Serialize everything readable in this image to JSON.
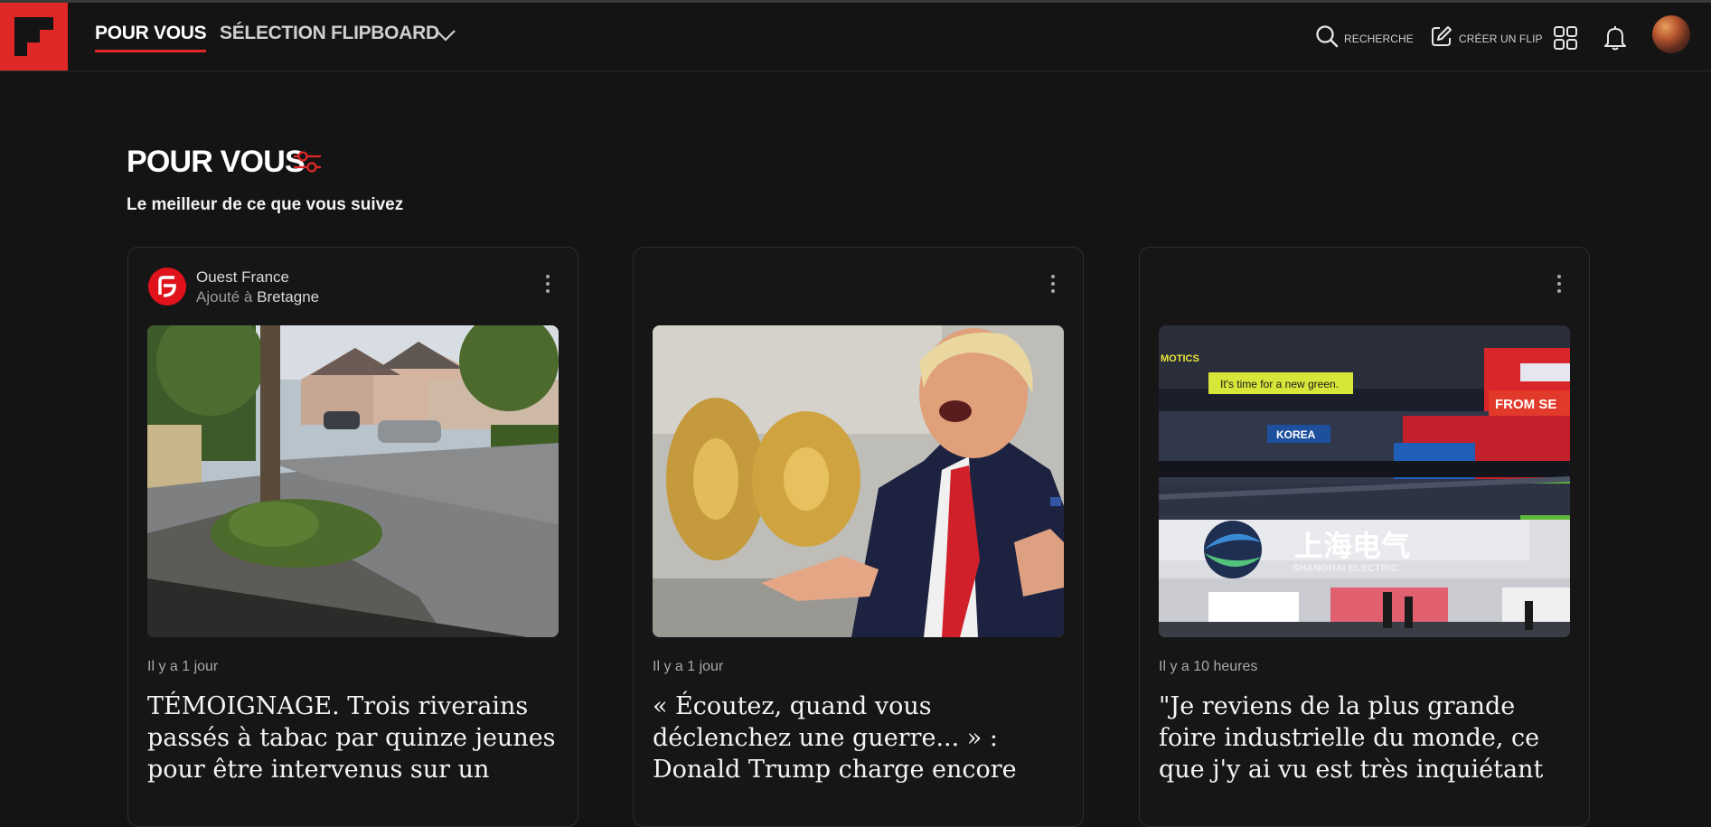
{
  "header": {
    "tabs": [
      {
        "label": "POUR VOUS",
        "active": true
      },
      {
        "label": "SÉLECTION FLIPBOARD",
        "active": false
      }
    ],
    "search_label": "RECHERCHE",
    "create_label": "CRÉER UN FLIP",
    "icons": [
      "flipboard-logo-icon",
      "chevron-down-icon",
      "search-icon",
      "edit-icon",
      "grid-icon",
      "bell-icon"
    ]
  },
  "section": {
    "title": "POUR VOUS",
    "subtitle": "Le meilleur de ce que vous suivez"
  },
  "cards": [
    {
      "source": "Ouest France",
      "added_prefix": "Ajouté à",
      "added_to": "Bretagne",
      "time": "Il y a 1 jour",
      "headline": "TÉMOIGNAGE. Trois riverains passés à tabac par quinze jeunes pour être intervenus sur un"
    },
    {
      "time": "Il y a 1 jour",
      "headline": "« Écoutez, quand vous déclenchez une guerre... » : Donald Trump charge encore"
    },
    {
      "time": "Il y a 10 heures",
      "headline": "\"Je reviens de la plus grande foire industrielle du monde, ce que j'y ai vu est très inquiétant"
    }
  ],
  "image_text": {
    "banner": "It's time for a new green.",
    "korea": "KOREA",
    "from_se": "FROM SE",
    "shanghai_cn": "上海电气",
    "shanghai_en": "SHANGHAI ELECTRIC",
    "motics": "MOTICS"
  },
  "colors": {
    "accent": "#e12828",
    "background": "#141414"
  }
}
